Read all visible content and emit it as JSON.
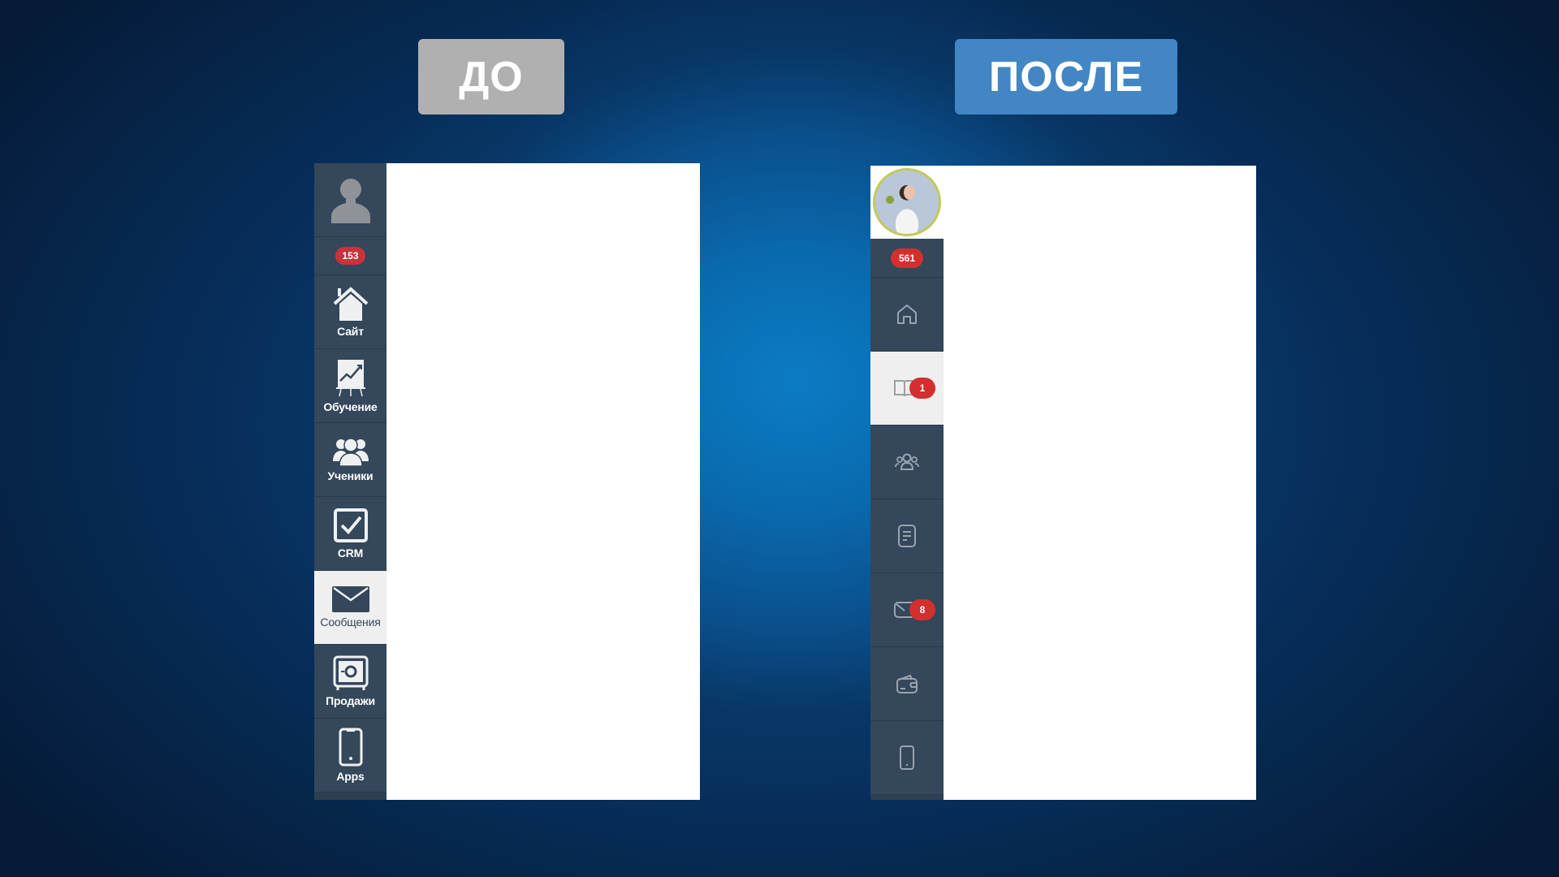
{
  "labels": {
    "before": "ДО",
    "after": "ПОСЛЕ"
  },
  "colors": {
    "before_label_bg": "#b0b0b0",
    "after_label_bg": "#4286c4",
    "sidebar_bg": "#34475b",
    "badge_red": "#d32f2f",
    "active_bg": "#efefef"
  },
  "before": {
    "avatar_icon": "user-silhouette-icon",
    "notifications_count": "153",
    "items": [
      {
        "id": "site",
        "label": "Сайт",
        "icon": "house-icon",
        "active": false
      },
      {
        "id": "learning",
        "label": "Обучение",
        "icon": "chart-board-icon",
        "active": false
      },
      {
        "id": "students",
        "label": "Ученики",
        "icon": "users-group-icon",
        "active": false
      },
      {
        "id": "crm",
        "label": "CRM",
        "icon": "checkbox-icon",
        "active": false
      },
      {
        "id": "messages",
        "label": "Сообщения",
        "icon": "envelope-icon",
        "active": true
      },
      {
        "id": "sales",
        "label": "Продажи",
        "icon": "safe-icon",
        "active": false
      },
      {
        "id": "apps",
        "label": "Apps",
        "icon": "smartphone-icon",
        "active": false
      }
    ]
  },
  "after": {
    "avatar": "user-photo",
    "notifications_count": "561",
    "items": [
      {
        "id": "site",
        "icon": "home-outline-icon",
        "active": false,
        "badge": null
      },
      {
        "id": "learning",
        "icon": "book-outline-icon",
        "active": true,
        "badge": "1"
      },
      {
        "id": "students",
        "icon": "users-outline-icon",
        "active": false,
        "badge": null
      },
      {
        "id": "crm",
        "icon": "document-outline-icon",
        "active": false,
        "badge": null
      },
      {
        "id": "messages",
        "icon": "mail-outline-icon",
        "active": false,
        "badge": "8"
      },
      {
        "id": "sales",
        "icon": "wallet-outline-icon",
        "active": false,
        "badge": null
      },
      {
        "id": "apps",
        "icon": "phone-outline-icon",
        "active": false,
        "badge": null
      }
    ]
  }
}
